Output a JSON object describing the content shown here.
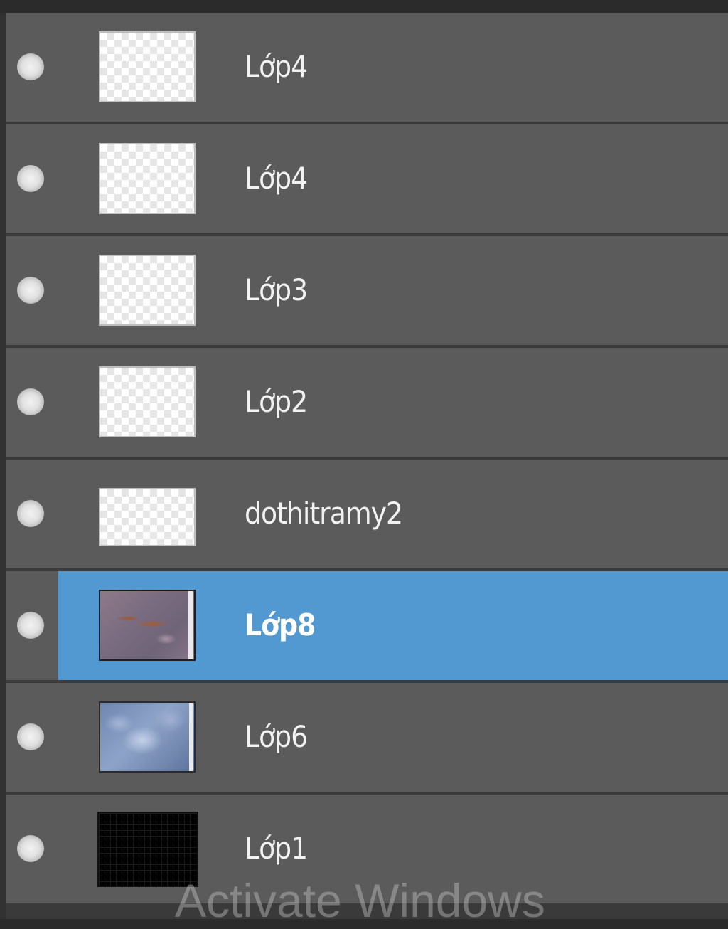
{
  "layers_panel": {
    "layers": [
      {
        "name": "Lớp4",
        "visible": true,
        "thumbnail": "transparent"
      },
      {
        "name": "Lớp4",
        "visible": true,
        "thumbnail": "transparent"
      },
      {
        "name": "Lớp3",
        "visible": true,
        "thumbnail": "transparent"
      },
      {
        "name": "Lớp2",
        "visible": true,
        "thumbnail": "transparent"
      },
      {
        "name": "dothitramy2",
        "visible": true,
        "thumbnail": "transparent"
      },
      {
        "name": "Lớp8",
        "visible": true,
        "thumbnail": "photo-purple",
        "selected": true
      },
      {
        "name": "Lớp6",
        "visible": true,
        "thumbnail": "photo-blue"
      },
      {
        "name": "Lớp1",
        "visible": true,
        "thumbnail": "black-grid"
      }
    ],
    "selected_color": "#5298d1",
    "row_color": "#5b5b5b"
  },
  "watermark": {
    "text": "Activate Windows"
  }
}
